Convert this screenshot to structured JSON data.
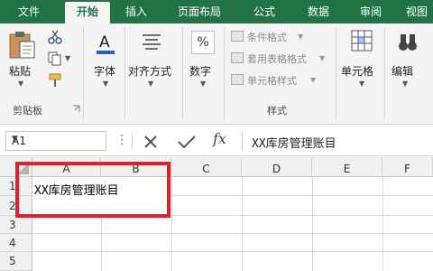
{
  "tabs": {
    "file": "文件",
    "home": "开始",
    "insert": "插入",
    "page_layout": "页面布局",
    "formulas": "公式",
    "data": "数据",
    "review": "审阅",
    "view": "视图"
  },
  "ribbon": {
    "clipboard": {
      "paste": "粘贴",
      "group_label": "剪贴板",
      "icons": [
        "paste-icon",
        "cut-icon",
        "copy-icon",
        "format-painter-icon",
        "dialog-launcher-icon"
      ]
    },
    "font": {
      "label": "字体"
    },
    "alignment": {
      "label": "对齐方式"
    },
    "number": {
      "label": "数字"
    },
    "styles": {
      "conditional_formatting": "条件格式",
      "format_as_table": "套用表格格式",
      "cell_styles": "单元格样式",
      "group_label": "样式"
    },
    "cells": {
      "label": "单元格"
    },
    "editing": {
      "label": "编辑"
    }
  },
  "formula_bar": {
    "name_box": "A1",
    "fx": "fx",
    "content": "XX库房管理账目"
  },
  "grid": {
    "columns": [
      "A",
      "B",
      "C",
      "D",
      "E",
      "F"
    ],
    "rows": [
      "1",
      "2",
      "3",
      "4",
      "5"
    ],
    "a1_value": "XX库房管理账目"
  },
  "colors": {
    "tabbar": "#217346",
    "ribbon": "#f4f4f4",
    "highlight": "#e0202c"
  }
}
